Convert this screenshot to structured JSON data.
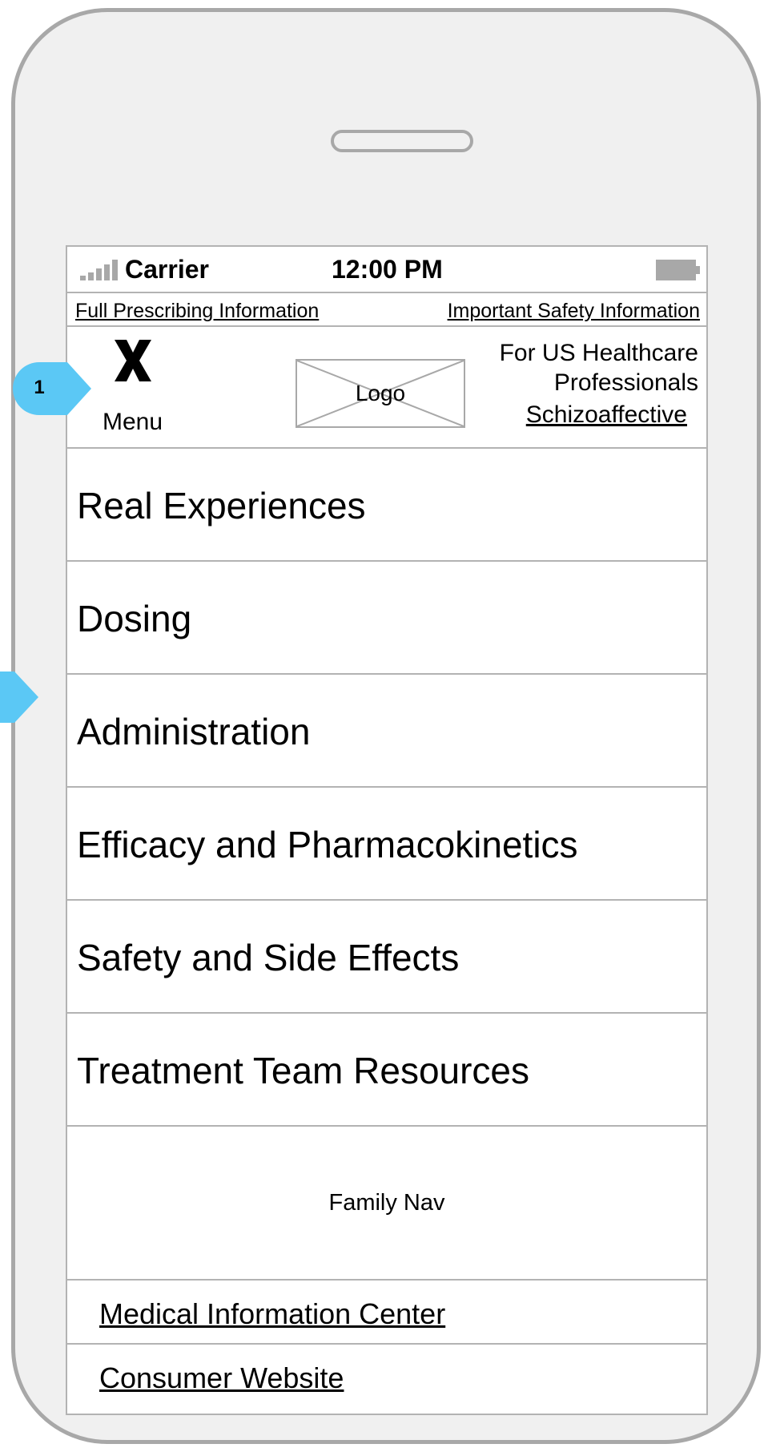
{
  "status_bar": {
    "carrier": "Carrier",
    "time": "12:00 PM"
  },
  "info_links": {
    "prescribing": "Full Prescribing Information",
    "safety": "Important Safety Information"
  },
  "header": {
    "menu_label": "Menu",
    "logo_label": "Logo",
    "audience": "For US Healthcare Professionals",
    "indication_link": "Schizoaffective"
  },
  "menu": {
    "items": [
      {
        "label": "Real Experiences"
      },
      {
        "label": "Dosing"
      },
      {
        "label": "Administration"
      },
      {
        "label": "Efficacy and Pharmacokinetics"
      },
      {
        "label": "Safety and Side Effects"
      },
      {
        "label": "Treatment Team Resources"
      }
    ]
  },
  "family_nav": {
    "label": "Family Nav"
  },
  "footer": {
    "medical_info": "Medical Information Center",
    "consumer": "Consumer Website"
  },
  "annotations": {
    "callout_1": "1"
  },
  "colors": {
    "frame": "#a8a8a8",
    "phone_bg": "#f0f0f0",
    "divider": "#b3b3b3",
    "callout": "#5bc8f5"
  }
}
